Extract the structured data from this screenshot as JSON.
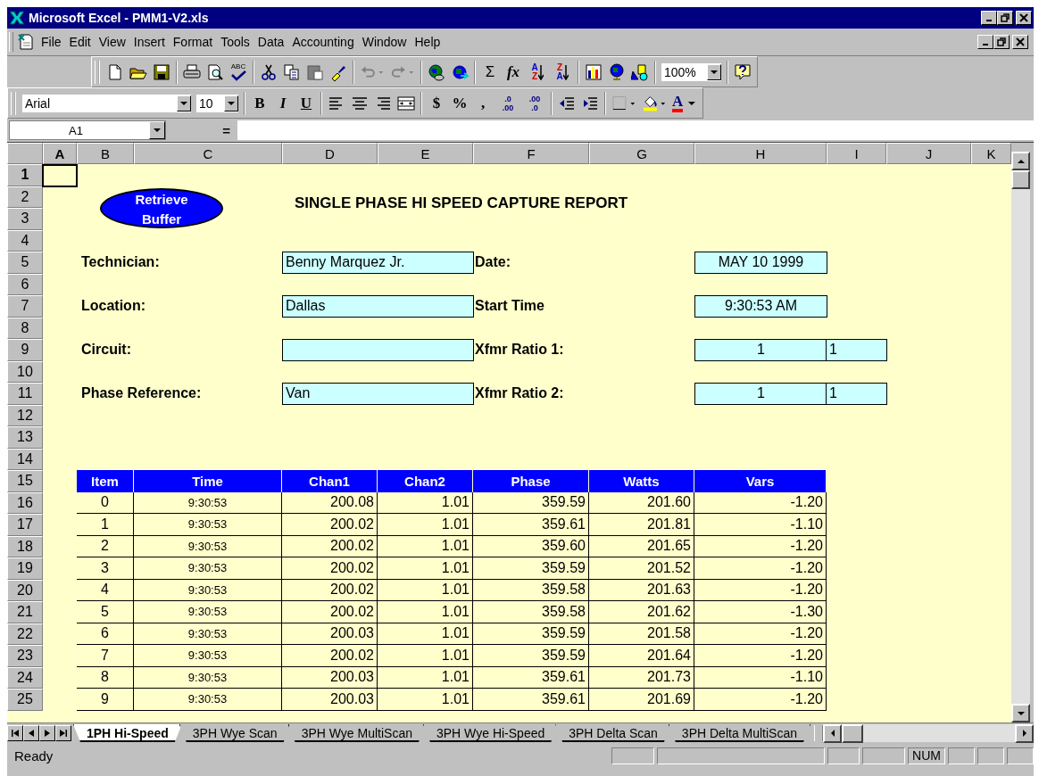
{
  "window": {
    "title": "Microsoft Excel - PMM1-V2.xls"
  },
  "menu": [
    "File",
    "Edit",
    "View",
    "Insert",
    "Format",
    "Tools",
    "Data",
    "Accounting",
    "Window",
    "Help"
  ],
  "standard_toolbar": {
    "spelling": "ABC",
    "sum": "Σ",
    "function": "fx",
    "sort_ascending": [
      "A",
      "Z"
    ],
    "sort_descending": [
      "Z",
      "A"
    ],
    "zoom": "100%"
  },
  "formatting_toolbar": {
    "font": "Arial",
    "size": "10",
    "bold": "B",
    "italic": "I",
    "underline": "U",
    "currency": "$",
    "percent": "%",
    "comma": ",",
    "increase_decimal": [
      ".0",
      ".00"
    ],
    "decrease_decimal": [
      ".00",
      ".0"
    ],
    "font_color": "A"
  },
  "formula_bar": {
    "name_box": "A1",
    "equals": "="
  },
  "sheet": {
    "columns": [
      {
        "label": "A",
        "selected": true
      },
      {
        "label": "B",
        "selected": false
      },
      {
        "label": "C",
        "selected": false
      },
      {
        "label": "D",
        "selected": false
      },
      {
        "label": "E",
        "selected": false
      },
      {
        "label": "F",
        "selected": false
      },
      {
        "label": "G",
        "selected": false
      },
      {
        "label": "H",
        "selected": false
      },
      {
        "label": "I",
        "selected": false
      },
      {
        "label": "J",
        "selected": false
      },
      {
        "label": "K",
        "selected": false
      }
    ],
    "rows": [
      {
        "label": "1",
        "selected": true
      },
      {
        "label": "2",
        "selected": false
      },
      {
        "label": "3",
        "selected": false
      },
      {
        "label": "4",
        "selected": false
      },
      {
        "label": "5",
        "selected": false
      },
      {
        "label": "6",
        "selected": false
      },
      {
        "label": "7",
        "selected": false
      },
      {
        "label": "8",
        "selected": false
      },
      {
        "label": "9",
        "selected": false
      },
      {
        "label": "10",
        "selected": false
      },
      {
        "label": "11",
        "selected": false
      },
      {
        "label": "12",
        "selected": false
      },
      {
        "label": "13",
        "selected": false
      },
      {
        "label": "14",
        "selected": false
      },
      {
        "label": "15",
        "selected": false
      },
      {
        "label": "16",
        "selected": false
      },
      {
        "label": "17",
        "selected": false
      },
      {
        "label": "18",
        "selected": false
      },
      {
        "label": "19",
        "selected": false
      },
      {
        "label": "20",
        "selected": false
      },
      {
        "label": "21",
        "selected": false
      },
      {
        "label": "22",
        "selected": false
      },
      {
        "label": "23",
        "selected": false
      },
      {
        "label": "24",
        "selected": false
      },
      {
        "label": "25",
        "selected": false
      }
    ],
    "button": "Retrieve Buffer",
    "report_title": "SINGLE PHASE HI SPEED CAPTURE REPORT",
    "fields_left": [
      {
        "label": "Technician:",
        "value": "Benny Marquez Jr."
      },
      {
        "label": "Location:",
        "value": "Dallas"
      },
      {
        "label": "Circuit:"
      },
      {
        "label": "Phase Reference:",
        "value": "Van"
      }
    ],
    "fields_right": [
      {
        "label": "Date:",
        "value": "MAY 10 1999"
      },
      {
        "label": "Start Time",
        "value": "9:30:53 AM"
      },
      {
        "label": "Xfmr Ratio 1:",
        "value": "1",
        "value2": "1"
      },
      {
        "label": "Xfmr Ratio 2:",
        "value": "1",
        "value2": "1"
      }
    ],
    "table": {
      "columns": [
        "Item",
        "Time",
        "Chan1",
        "Chan2",
        "Phase",
        "Watts",
        "Vars"
      ],
      "rows": [
        [
          "0",
          "9:30:53",
          "200.08",
          "1.01",
          "359.59",
          "201.60",
          "-1.20"
        ],
        [
          "1",
          "9:30:53",
          "200.02",
          "1.01",
          "359.61",
          "201.81",
          "-1.10"
        ],
        [
          "2",
          "9:30:53",
          "200.02",
          "1.01",
          "359.60",
          "201.65",
          "-1.20"
        ],
        [
          "3",
          "9:30:53",
          "200.02",
          "1.01",
          "359.59",
          "201.52",
          "-1.20"
        ],
        [
          "4",
          "9:30:53",
          "200.02",
          "1.01",
          "359.58",
          "201.63",
          "-1.20"
        ],
        [
          "5",
          "9:30:53",
          "200.02",
          "1.01",
          "359.58",
          "201.62",
          "-1.30"
        ],
        [
          "6",
          "9:30:53",
          "200.03",
          "1.01",
          "359.59",
          "201.58",
          "-1.20"
        ],
        [
          "7",
          "9:30:53",
          "200.02",
          "1.01",
          "359.59",
          "201.64",
          "-1.20"
        ],
        [
          "8",
          "9:30:53",
          "200.03",
          "1.01",
          "359.61",
          "201.73",
          "-1.10"
        ],
        [
          "9",
          "9:30:53",
          "200.03",
          "1.01",
          "359.61",
          "201.69",
          "-1.20"
        ]
      ]
    }
  },
  "sheet_tabs": [
    {
      "label": "1PH Hi-Speed",
      "selected": true
    },
    {
      "label": "3PH Wye Scan",
      "selected": false
    },
    {
      "label": "3PH Wye MultiScan",
      "selected": false
    },
    {
      "label": "3PH Wye Hi-Speed",
      "selected": false
    },
    {
      "label": "3PH Delta Scan",
      "selected": false
    },
    {
      "label": "3PH Delta MultiScan",
      "selected": false
    }
  ],
  "status_bar": {
    "text": "Ready",
    "num": "NUM"
  }
}
